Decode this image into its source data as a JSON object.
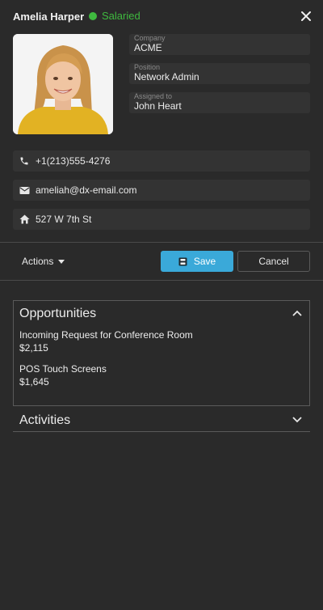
{
  "header": {
    "name": "Amelia Harper",
    "status": "Salaried",
    "status_color": "#3fb93f",
    "close_icon": "close-icon"
  },
  "fields": {
    "company": {
      "label": "Company",
      "value": "ACME"
    },
    "position": {
      "label": "Position",
      "value": "Network Admin"
    },
    "assigned": {
      "label": "Assigned to",
      "value": "John Heart"
    }
  },
  "contacts": {
    "phone": {
      "icon": "phone-icon",
      "value": "+1(213)555-4276"
    },
    "email": {
      "icon": "mail-icon",
      "value": "ameliah@dx-email.com"
    },
    "address": {
      "icon": "home-icon",
      "value": "527 W 7th St"
    }
  },
  "toolbar": {
    "actions_label": "Actions",
    "save_label": "Save",
    "cancel_label": "Cancel",
    "accent": "#3aa9d9"
  },
  "opportunities": {
    "title": "Opportunities",
    "items": [
      {
        "name": "Incoming Request for Conference Room",
        "amount": "$2,115"
      },
      {
        "name": "POS Touch Screens",
        "amount": "$1,645"
      }
    ]
  },
  "activities": {
    "title": "Activities"
  }
}
